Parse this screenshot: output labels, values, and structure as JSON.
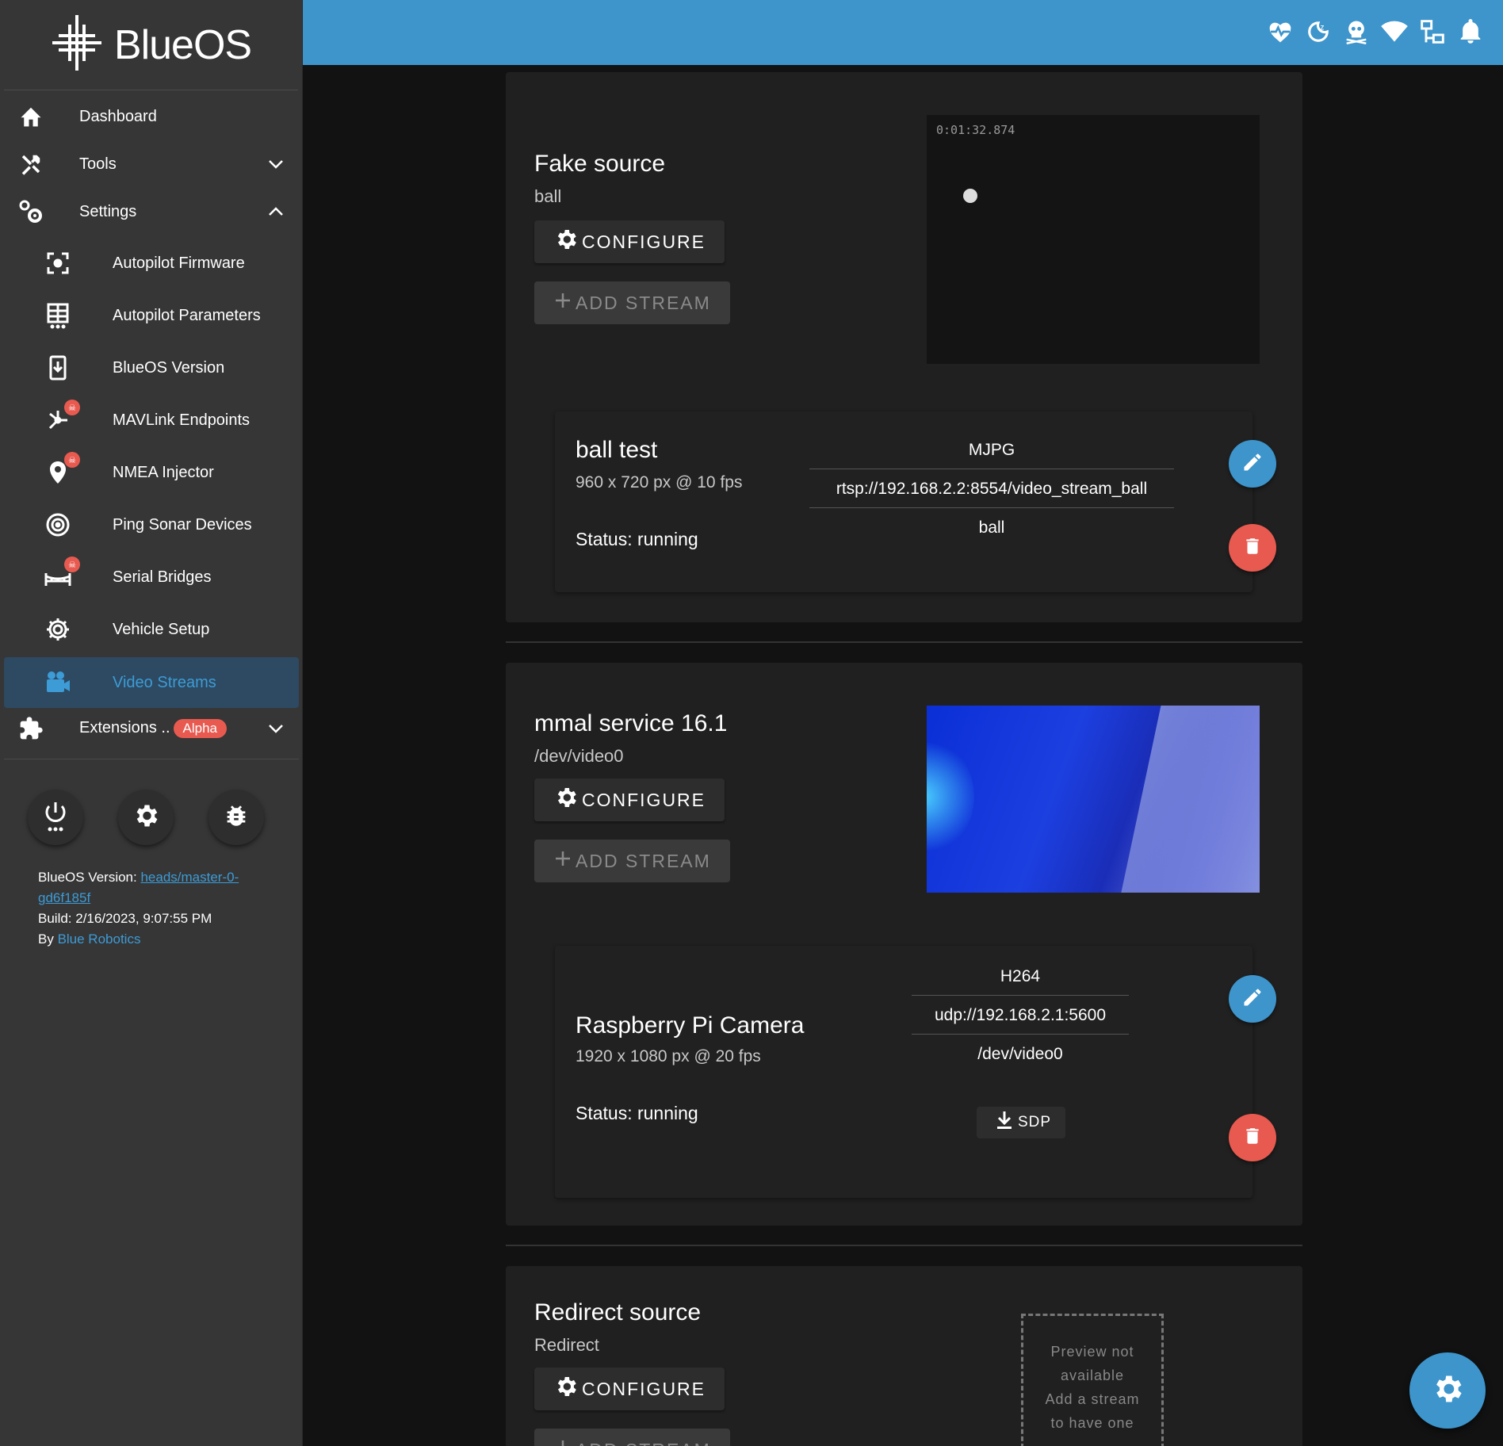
{
  "app": {
    "logo_text": "BlueOS"
  },
  "sidebar": {
    "dashboard": "Dashboard",
    "tools": "Tools",
    "settings": "Settings",
    "sub_items": [
      "Autopilot Firmware",
      "Autopilot Parameters",
      "BlueOS Version",
      "MAVLink Endpoints",
      "NMEA Injector",
      "Ping Sonar Devices",
      "Serial Bridges",
      "Vehicle Setup",
      "Video Streams"
    ],
    "extensions": "Extensions ..",
    "alpha_badge": "Alpha",
    "version_label": "BlueOS Version: ",
    "version_link": "heads/master-0-gd6f185f",
    "build": "Build: 2/16/2023, 9:07:55 PM",
    "by_label": "By ",
    "by_link": "Blue Robotics"
  },
  "topbar": {
    "icons": [
      "heart-pulse-icon",
      "sleep-icon",
      "skull-icon",
      "wifi-icon",
      "network-icon",
      "bell-icon"
    ]
  },
  "buttons": {
    "configure": "CONFIGURE",
    "add_stream": "ADD STREAM",
    "sdp": "SDP"
  },
  "devices": [
    {
      "name": "Fake source",
      "source": "ball",
      "preview_timestamp": "0:01:32.874",
      "stream": {
        "name": "ball test",
        "resolution": "960 x 720 px @ 10 fps",
        "status": "Status: running",
        "encode": "MJPG",
        "endpoint": "rtsp://192.168.2.2:8554/video_stream_ball",
        "source": "ball"
      }
    },
    {
      "name": "mmal service 16.1",
      "source": "/dev/video0",
      "stream": {
        "name": "Raspberry Pi Camera",
        "resolution": "1920 x 1080 px @ 20 fps",
        "status": "Status: running",
        "encode": "H264",
        "endpoint": "udp://192.168.2.1:5600",
        "source": "/dev/video0"
      }
    },
    {
      "name": "Redirect source",
      "source": "Redirect",
      "no_preview": [
        "Preview not",
        "available",
        "Add a stream",
        "to have one"
      ]
    }
  ],
  "colors": {
    "accent": "#3d95cc",
    "danger": "#e85a50",
    "sidebar": "#363636",
    "background": "#121212"
  }
}
